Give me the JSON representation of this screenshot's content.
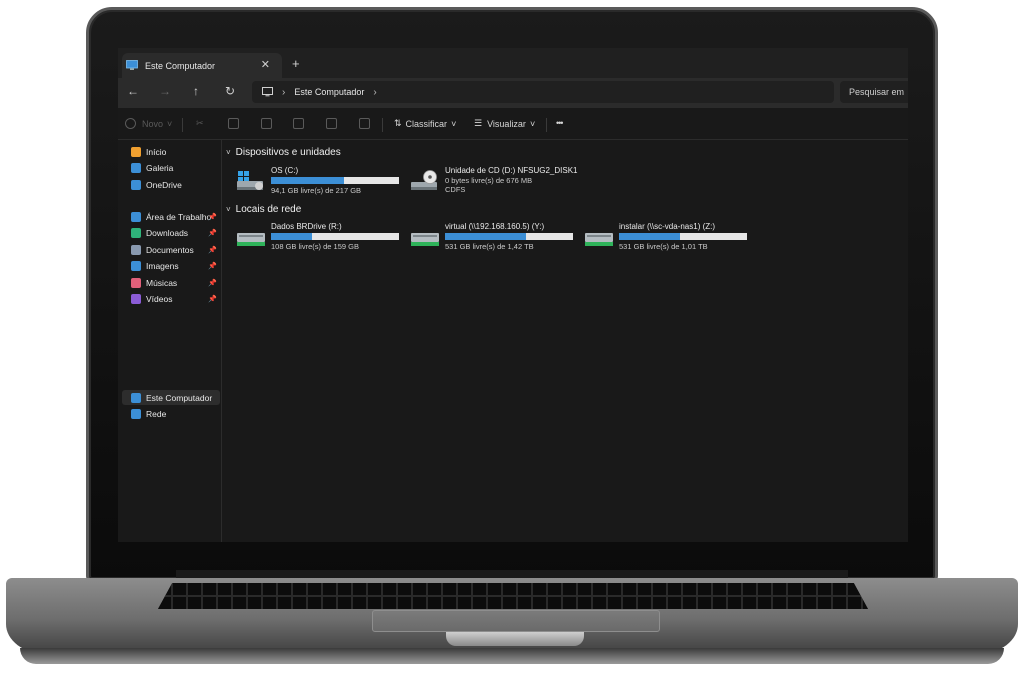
{
  "window": {
    "tab_title": "Este Computador",
    "close_glyph": "✕",
    "new_tab_glyph": "+"
  },
  "nav": {
    "back_glyph": "←",
    "forward_glyph": "→",
    "up_glyph": "↑",
    "refresh_glyph": "↻",
    "address_location": "Este Computador",
    "chevron_glyph": "›",
    "search_placeholder": "Pesquisar em"
  },
  "toolbar": {
    "new_label": "Novo",
    "new_caret": "˅",
    "sort_label": "Classificar",
    "sort_caret": "˅",
    "view_label": "Visualizar",
    "view_caret": "˅",
    "more_glyph": "•••"
  },
  "sidebar": {
    "top_items": [
      {
        "label": "Início",
        "icon": "home-icon",
        "color": "#f0a030"
      },
      {
        "label": "Galeria",
        "icon": "gallery-icon",
        "color": "#3c8fd6"
      },
      {
        "label": "OneDrive",
        "icon": "cloud-icon",
        "color": "#3c8fd6"
      }
    ],
    "pinned_items": [
      {
        "label": "Área de Trabalho",
        "icon": "desktop-icon",
        "color": "#3c8fd6"
      },
      {
        "label": "Downloads",
        "icon": "download-icon",
        "color": "#2fb37a"
      },
      {
        "label": "Documentos",
        "icon": "document-icon",
        "color": "#8a9ab0"
      },
      {
        "label": "Imagens",
        "icon": "image-icon",
        "color": "#3c8fd6"
      },
      {
        "label": "Músicas",
        "icon": "music-icon",
        "color": "#e0607a"
      },
      {
        "label": "Vídeos",
        "icon": "video-icon",
        "color": "#8b5cd6"
      }
    ],
    "pin_glyph": "📌",
    "bottom_items": [
      {
        "label": "Este Computador",
        "icon": "computer-icon",
        "color": "#3c8fd6",
        "selected": true
      },
      {
        "label": "Rede",
        "icon": "network-icon",
        "color": "#3c8fd6",
        "selected": false
      }
    ]
  },
  "content": {
    "devices_title": "Dispositivos e unidades",
    "network_title": "Locais de rede",
    "caret_glyph": "˅",
    "devices": [
      {
        "name": "OS (C:)",
        "free": "94,1 GB livre(s) de 217 GB",
        "used_fraction": 0.57,
        "kind": "os"
      },
      {
        "name": "Unidade de CD (D:) NFSUG2_DISK1",
        "free": "0 bytes livre(s) de 676 MB",
        "fs": "CDFS",
        "kind": "cd"
      }
    ],
    "network": [
      {
        "name": "Dados BRDrive (R:)",
        "free": "108 GB livre(s) de 159 GB",
        "used_fraction": 0.32
      },
      {
        "name": "virtual (\\\\192.168.160.5) (Y:)",
        "free": "531 GB livre(s) de 1,42 TB",
        "used_fraction": 0.63
      },
      {
        "name": "instalar (\\\\sc-vda-nas1) (Z:)",
        "free": "531 GB livre(s) de 1,01 TB",
        "used_fraction": 0.48
      }
    ]
  }
}
